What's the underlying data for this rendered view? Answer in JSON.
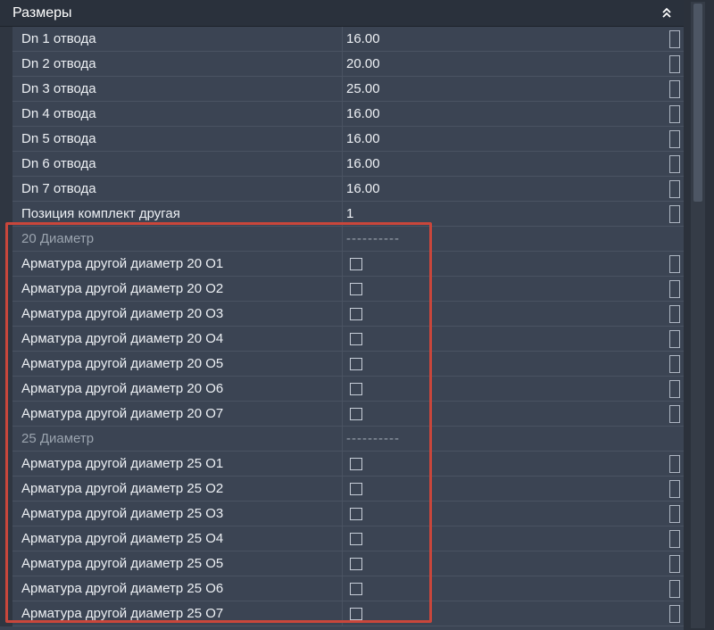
{
  "header": {
    "title": "Размеры",
    "collapse_icon": "double-chevron-up-icon"
  },
  "dimension_rows": [
    {
      "name": "Dn 1 отвода",
      "value": "16.00"
    },
    {
      "name": "Dn 2 отвода",
      "value": "20.00"
    },
    {
      "name": "Dn 3 отвода",
      "value": "25.00"
    },
    {
      "name": "Dn 4 отвода",
      "value": "16.00"
    },
    {
      "name": "Dn 5 отвода",
      "value": "16.00"
    },
    {
      "name": "Dn 6 отвода",
      "value": "16.00"
    },
    {
      "name": "Dn 7 отвода",
      "value": "16.00"
    },
    {
      "name": "Позиция комплект другая",
      "value": "1"
    }
  ],
  "category_20": {
    "name": "20 Диаметр",
    "value": "----------"
  },
  "rows_20": [
    {
      "name": "Арматура другой диаметр 20 O1",
      "checked": false
    },
    {
      "name": "Арматура другой диаметр 20 O2",
      "checked": false
    },
    {
      "name": "Арматура другой диаметр 20 O3",
      "checked": false
    },
    {
      "name": "Арматура другой диаметр 20 O4",
      "checked": false
    },
    {
      "name": "Арматура другой диаметр 20 O5",
      "checked": false
    },
    {
      "name": "Арматура другой диаметр 20 O6",
      "checked": false
    },
    {
      "name": "Арматура другой диаметр 20 O7",
      "checked": false
    }
  ],
  "category_25": {
    "name": "25 Диаметр",
    "value": "----------"
  },
  "rows_25": [
    {
      "name": "Арматура другой диаметр 25 O1",
      "checked": false
    },
    {
      "name": "Арматура другой диаметр 25 O2",
      "checked": false
    },
    {
      "name": "Арматура другой диаметр 25 O3",
      "checked": false
    },
    {
      "name": "Арматура другой диаметр 25 O4",
      "checked": false
    },
    {
      "name": "Арматура другой диаметр 25 O5",
      "checked": false
    },
    {
      "name": "Арматура другой диаметр 25 O6",
      "checked": false
    },
    {
      "name": "Арматура другой диаметр 25 O7",
      "checked": false
    }
  ],
  "colors": {
    "panel_bg": "#3b4453",
    "header_bg": "#2a313c",
    "highlight_border": "#c9463b",
    "category_text": "#9aa3ae"
  }
}
